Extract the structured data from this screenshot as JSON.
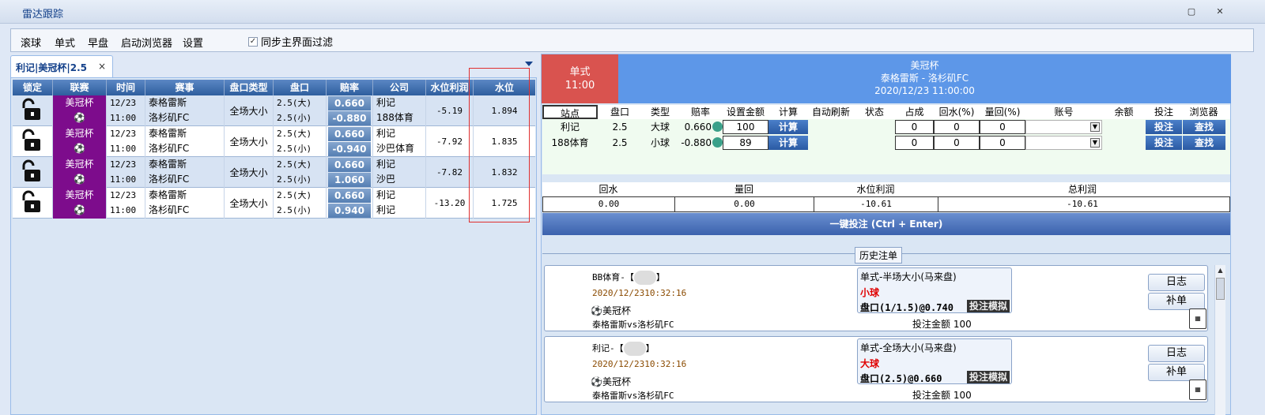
{
  "window": {
    "title": "雷达跟踪",
    "restore_glyph": "▢",
    "close_glyph": "✕"
  },
  "menu": {
    "items": [
      "滚球",
      "单式",
      "早盘",
      "启动浏览器",
      "设置"
    ],
    "sync_label": "同步主界面过滤",
    "sync_checked": true
  },
  "tab": {
    "label": "利记|美冠杯|2.5",
    "close": "×"
  },
  "left_table": {
    "headers": [
      "锁定",
      "联赛",
      "时间",
      "赛事",
      "盘口类型",
      "盘口",
      "赔率",
      "公司",
      "水位利润",
      "水位"
    ],
    "rows": [
      {
        "league": "美冠杯",
        "date": "12/23",
        "time": "11:00",
        "home": "泰格雷斯",
        "away": "洛杉矶FC",
        "type": "全场大小",
        "line1": "2.5(大)",
        "line2": "2.5(小)",
        "odds1": "0.660",
        "odds2": "-0.880",
        "co1": "利记",
        "co2": "188体育",
        "profit": "-5.19",
        "water": "1.894"
      },
      {
        "league": "美冠杯",
        "date": "12/23",
        "time": "11:00",
        "home": "泰格雷斯",
        "away": "洛杉矶FC",
        "type": "全场大小",
        "line1": "2.5(大)",
        "line2": "2.5(小)",
        "odds1": "0.660",
        "odds2": "-0.940",
        "co1": "利记",
        "co2": "沙巴体育",
        "profit": "-7.92",
        "water": "1.835"
      },
      {
        "league": "美冠杯",
        "date": "12/23",
        "time": "11:00",
        "home": "泰格雷斯",
        "away": "洛杉矶FC",
        "type": "全场大小",
        "line1": "2.5(大)",
        "line2": "2.5(小)",
        "odds1": "0.660",
        "odds2": "1.060",
        "co1": "利记",
        "co2": "沙巴",
        "profit": "-7.82",
        "water": "1.832"
      },
      {
        "league": "美冠杯",
        "date": "12/23",
        "time": "11:00",
        "home": "泰格雷斯",
        "away": "洛杉矶FC",
        "type": "全场大小",
        "line1": "2.5(大)",
        "line2": "2.5(小)",
        "odds1": "0.660",
        "odds2": "0.940",
        "co1": "利记",
        "co2": "利记",
        "profit": "-13.20",
        "water": "1.725"
      }
    ]
  },
  "right": {
    "market": "单式",
    "kickoff": "11:00",
    "league": "美冠杯",
    "match": "泰格雷斯 - 洛杉矶FC",
    "datetime": "2020/12/23 11:00:00",
    "bet_headers": [
      "站点",
      "盘口",
      "类型",
      "赔率",
      "设置金额",
      "计算",
      "自动刷新",
      "状态",
      "占成",
      "回水(%)",
      "量回(%)",
      "账号",
      "余额",
      "投注",
      "浏览器"
    ],
    "bet_rows": [
      {
        "site": "利记",
        "line": "2.5",
        "type": "大球",
        "odds": "0.660",
        "amount": "100",
        "calc": "计算",
        "share": "0",
        "rebate": "0",
        "backflow": "0",
        "bet": "投注",
        "browser": "查找"
      },
      {
        "site": "188体育",
        "line": "2.5",
        "type": "小球",
        "odds": "-0.880",
        "amount": "89",
        "calc": "计算",
        "share": "0",
        "rebate": "0",
        "backflow": "0",
        "bet": "投注",
        "browser": "查找"
      }
    ],
    "summary_headers": [
      "回水",
      "量回",
      "水位利润",
      "总利润"
    ],
    "summary_values": [
      "0.00",
      "0.00",
      "-10.61",
      "-10.61"
    ],
    "one_click": "一键投注 (Ctrl + Enter)",
    "history_label": "历史注单",
    "history": [
      {
        "company": "BB体育-【",
        "company_end": "】",
        "time": "2020/12/2310:32:16",
        "league": "⚽美冠杯",
        "match": "泰格雷斯vs洛杉矶FC",
        "bet_title": "单式-半场大小(马来盘)",
        "bet_type": "小球",
        "bet_line": "盘口(1/1.5)@0.740",
        "sim": "投注模拟",
        "amount": "投注金额 100",
        "log": "日志",
        "fill": "补单"
      },
      {
        "company": "利记-【",
        "company_end": "】",
        "time": "2020/12/2310:32:16",
        "league": "⚽美冠杯",
        "match": "泰格雷斯vs洛杉矶FC",
        "bet_title": "单式-全场大小(马来盘)",
        "bet_type": "大球",
        "bet_line": "盘口(2.5)@0.660",
        "sim": "投注模拟",
        "amount": "投注金额 100",
        "log": "日志",
        "fill": "补单"
      }
    ]
  },
  "colors": {
    "league_purple": "#7d0c8c",
    "header_blue": "#5d97e8",
    "market_red": "#d9534f",
    "highlight_red": "#e03030"
  }
}
